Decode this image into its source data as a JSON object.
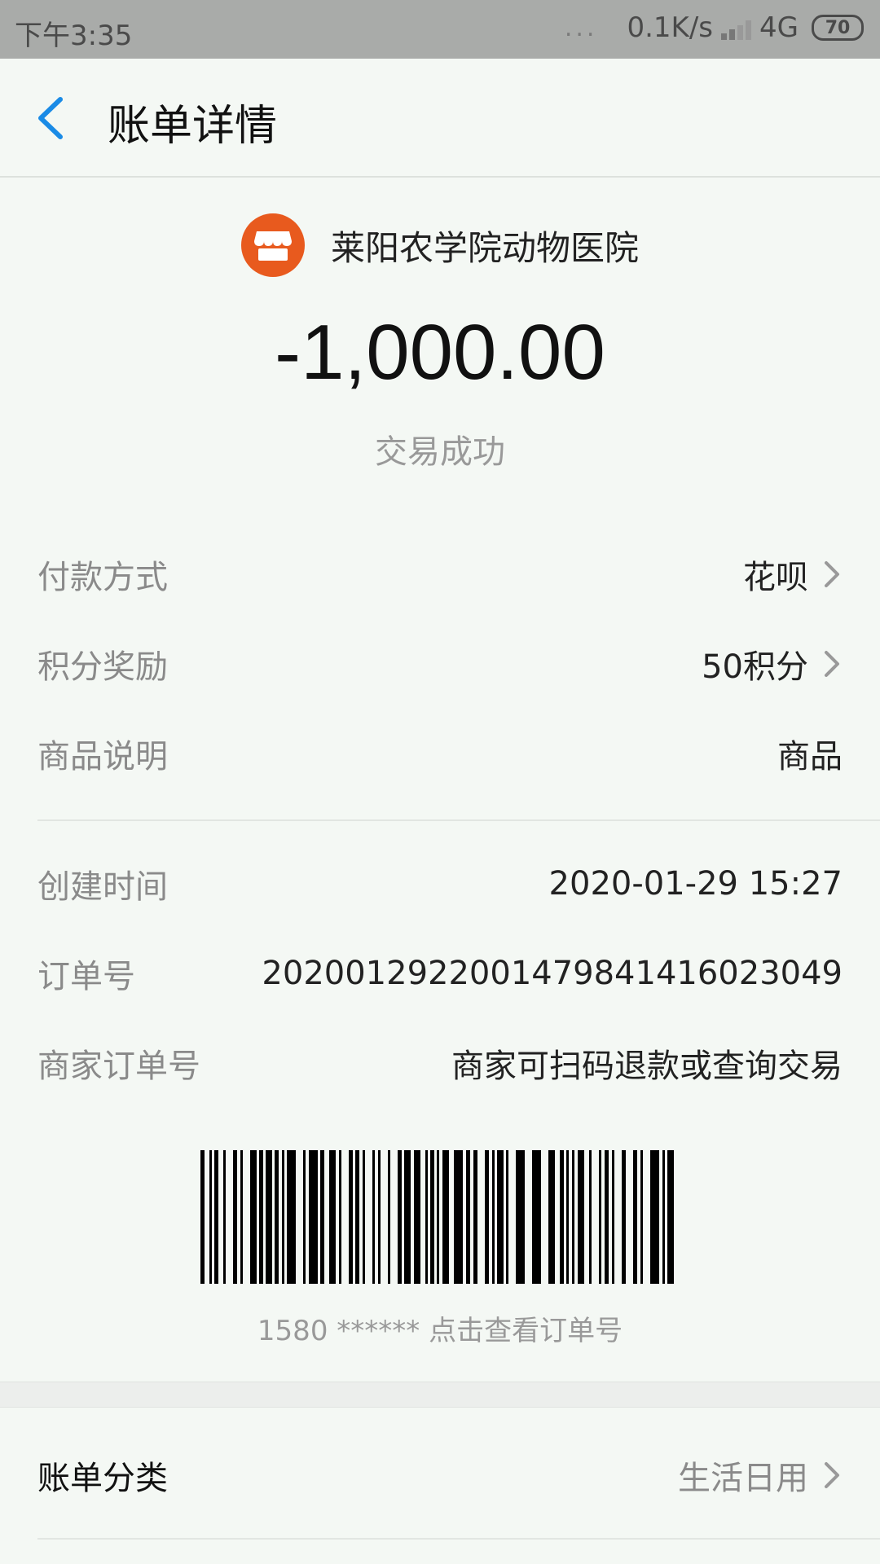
{
  "status_bar": {
    "time": "下午3:35",
    "dots": "...",
    "network_speed": "0.1K/s",
    "network_type": "4G",
    "battery": "70"
  },
  "header": {
    "back_icon": "back-chevron-icon",
    "title": "账单详情"
  },
  "merchant": {
    "icon": "store-icon",
    "icon_color": "#e85a1e",
    "name": "莱阳农学院动物医院",
    "amount": "-1,000.00",
    "status": "交易成功"
  },
  "details": [
    {
      "label": "付款方式",
      "value": "花呗",
      "has_arrow": true
    },
    {
      "label": "积分奖励",
      "value": "50积分",
      "has_arrow": true
    },
    {
      "label": "商品说明",
      "value": "商品",
      "has_arrow": false
    },
    {
      "label": "创建时间",
      "value": "2020-01-29 15:27",
      "has_arrow": false
    },
    {
      "label": "订单号",
      "value": "2020012922001479841416023049",
      "has_arrow": false
    },
    {
      "label": "商家订单号",
      "value": "商家可扫码退款或查询交易",
      "has_arrow": false
    }
  ],
  "barcode": {
    "caption": "1580 ****** 点击查看订单号"
  },
  "category": {
    "label": "账单分类",
    "value": "生活日用"
  }
}
